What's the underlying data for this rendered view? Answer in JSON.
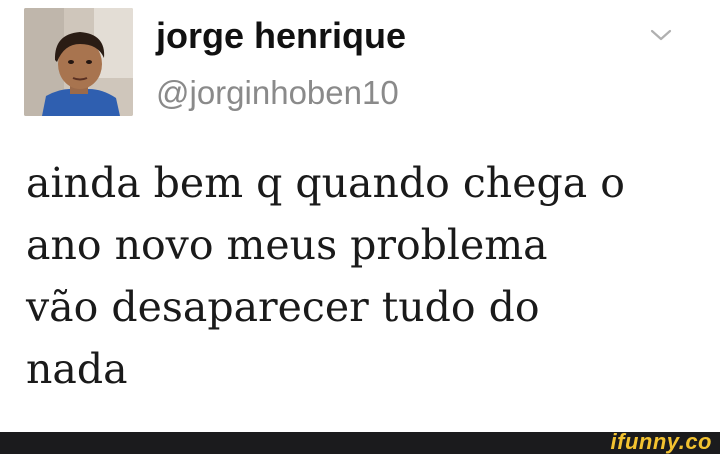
{
  "tweet": {
    "display_name": "jorge henrique",
    "handle": "@jorginhoben10",
    "text_lines": [
      "ainda bem q quando chega o",
      "ano novo meus problema",
      "vão desaparecer tudo do",
      "nada"
    ],
    "menu_icon": "chevron-down-icon",
    "avatar_icon": "profile-photo"
  },
  "watermark": {
    "text": "ifunny.co"
  },
  "colors": {
    "name": "#111111",
    "handle": "#8a8a8a",
    "text": "#1a1a1a",
    "footer_bg": "#1b1b1d",
    "watermark": "#f2c230"
  }
}
